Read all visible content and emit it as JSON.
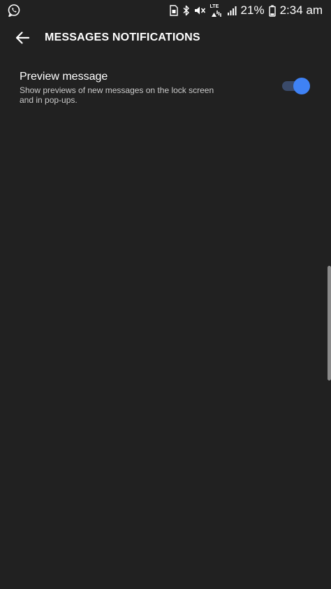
{
  "status_bar": {
    "battery_percent": "21%",
    "time": "2:34 am",
    "network_label": "LTE",
    "icons": [
      "whatsapp-icon",
      "sim-icon",
      "bluetooth-icon",
      "mute-icon",
      "lte-icon",
      "signal-icon",
      "battery-icon"
    ]
  },
  "header": {
    "back_icon": "arrow-left-icon",
    "title": "MESSAGES NOTIFICATIONS"
  },
  "settings": [
    {
      "title": "Preview message",
      "description": "Show previews of new messages on the lock screen and in pop-ups.",
      "enabled": true
    }
  ],
  "colors": {
    "background": "#212121",
    "accent": "#3f82f5",
    "toggle_track": "#3a4a6a"
  }
}
